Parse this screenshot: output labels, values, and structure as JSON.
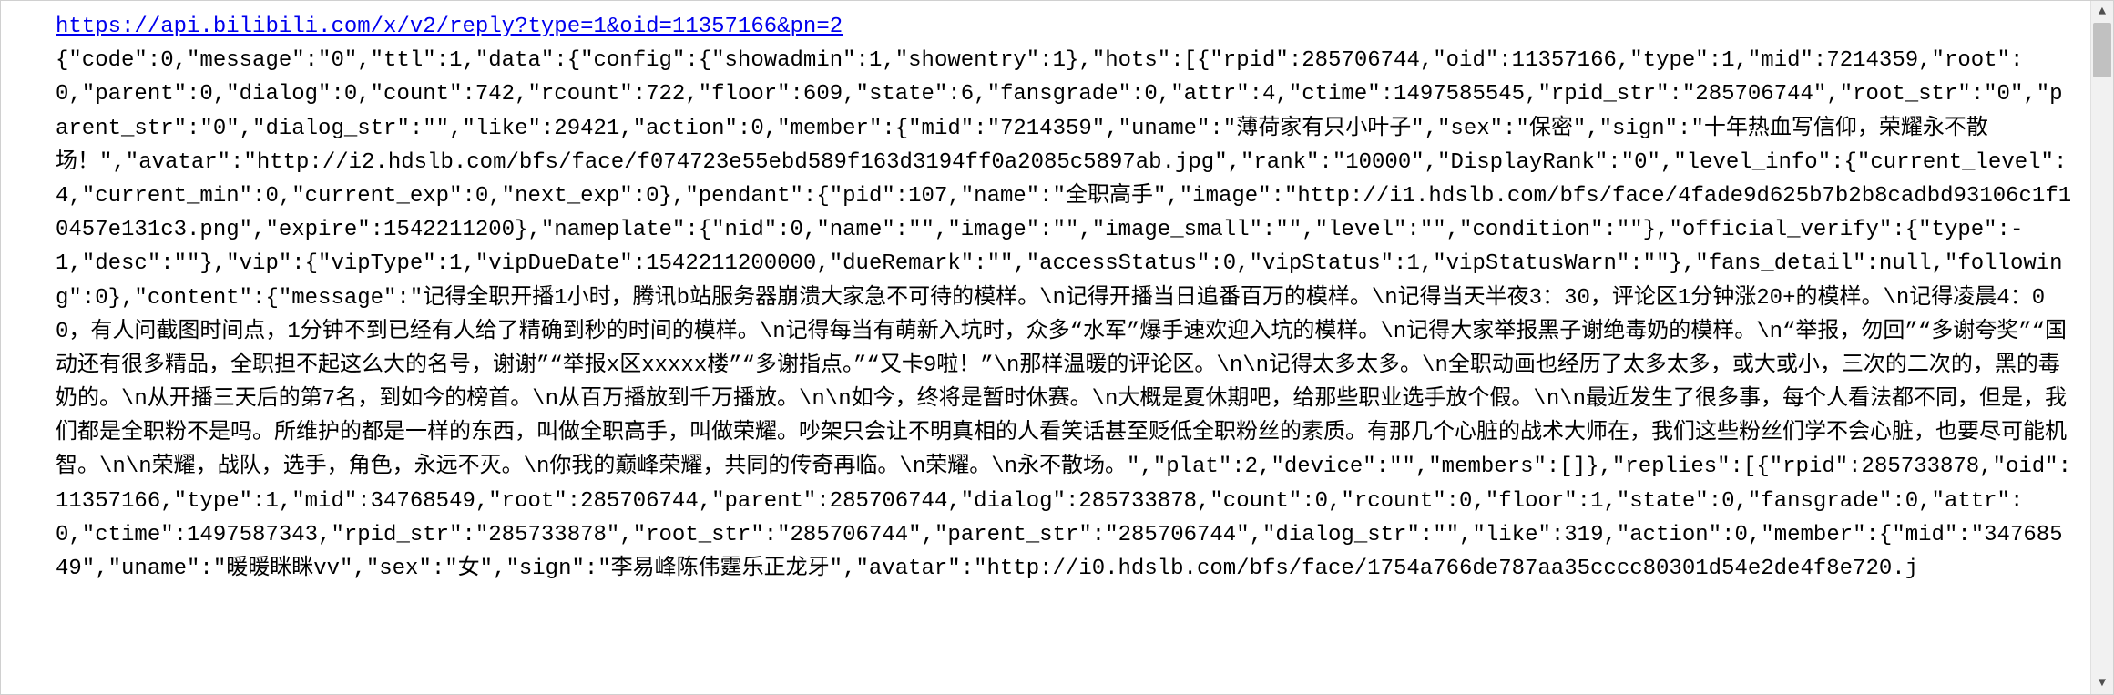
{
  "url": "https://api.bilibili.com/x/v2/reply?type=1&oid=11357166&pn=2",
  "body": "{\"code\":0,\"message\":\"0\",\"ttl\":1,\"data\":{\"config\":{\"showadmin\":1,\"showentry\":1},\"hots\":[{\"rpid\":285706744,\"oid\":11357166,\"type\":1,\"mid\":7214359,\"root\":0,\"parent\":0,\"dialog\":0,\"count\":742,\"rcount\":722,\"floor\":609,\"state\":6,\"fansgrade\":0,\"attr\":4,\"ctime\":1497585545,\"rpid_str\":\"285706744\",\"root_str\":\"0\",\"parent_str\":\"0\",\"dialog_str\":\"\",\"like\":29421,\"action\":0,\"member\":{\"mid\":\"7214359\",\"uname\":\"薄荷家有只小叶子\",\"sex\":\"保密\",\"sign\":\"十年热血写信仰，荣耀永不散场！\",\"avatar\":\"http://i2.hdslb.com/bfs/face/f074723e55ebd589f163d3194ff0a2085c5897ab.jpg\",\"rank\":\"10000\",\"DisplayRank\":\"0\",\"level_info\":{\"current_level\":4,\"current_min\":0,\"current_exp\":0,\"next_exp\":0},\"pendant\":{\"pid\":107,\"name\":\"全职高手\",\"image\":\"http://i1.hdslb.com/bfs/face/4fade9d625b7b2b8cadbd93106c1f10457e131c3.png\",\"expire\":1542211200},\"nameplate\":{\"nid\":0,\"name\":\"\",\"image\":\"\",\"image_small\":\"\",\"level\":\"\",\"condition\":\"\"},\"official_verify\":{\"type\":-1,\"desc\":\"\"},\"vip\":{\"vipType\":1,\"vipDueDate\":1542211200000,\"dueRemark\":\"\",\"accessStatus\":0,\"vipStatus\":1,\"vipStatusWarn\":\"\"},\"fans_detail\":null,\"following\":0},\"content\":{\"message\":\"记得全职开播1小时，腾讯b站服务器崩溃大家急不可待的模样。\\n记得开播当日追番百万的模样。\\n记得当天半夜3：30，评论区1分钟涨20+的模样。\\n记得凌晨4：00，有人问截图时间点，1分钟不到已经有人给了精确到秒的时间的模样。\\n记得每当有萌新入坑时，众多“水军”爆手速欢迎入坑的模样。\\n记得大家举报黑子谢绝毒奶的模样。\\n“举报，勿回”“多谢夸奖”“国动还有很多精品，全职担不起这么大的名号，谢谢”“举报x区xxxxx楼”“多谢指点。”“又卡9啦！”\\n那样温暖的评论区。\\n\\n记得太多太多。\\n全职动画也经历了太多太多，或大或小，三次的二次的，黑的毒奶的。\\n从开播三天后的第7名，到如今的榜首。\\n从百万播放到千万播放。\\n\\n如今，终将是暂时休赛。\\n大概是夏休期吧，给那些职业选手放个假。\\n\\n最近发生了很多事，每个人看法都不同，但是，我们都是全职粉不是吗。所维护的都是一样的东西，叫做全职高手，叫做荣耀。吵架只会让不明真相的人看笑话甚至贬低全职粉丝的素质。有那几个心脏的战术大师在，我们这些粉丝们学不会心脏，也要尽可能机智。\\n\\n荣耀，战队，选手，角色，永远不灭。\\n你我的巅峰荣耀，共同的传奇再临。\\n荣耀。\\n永不散场。\",\"plat\":2,\"device\":\"\",\"members\":[]},\"replies\":[{\"rpid\":285733878,\"oid\":11357166,\"type\":1,\"mid\":34768549,\"root\":285706744,\"parent\":285706744,\"dialog\":285733878,\"count\":0,\"rcount\":0,\"floor\":1,\"state\":0,\"fansgrade\":0,\"attr\":0,\"ctime\":1497587343,\"rpid_str\":\"285733878\",\"root_str\":\"285706744\",\"parent_str\":\"285706744\",\"dialog_str\":\"\",\"like\":319,\"action\":0,\"member\":{\"mid\":\"34768549\",\"uname\":\"暖暖眯眯vv\",\"sex\":\"女\",\"sign\":\"李易峰陈伟霆乐正龙牙\",\"avatar\":\"http://i0.hdslb.com/bfs/face/1754a766de787aa35cccc80301d54e2de4f8e720.j",
  "scrollbar": {
    "up_arrow": "▲",
    "down_arrow": "▼"
  }
}
